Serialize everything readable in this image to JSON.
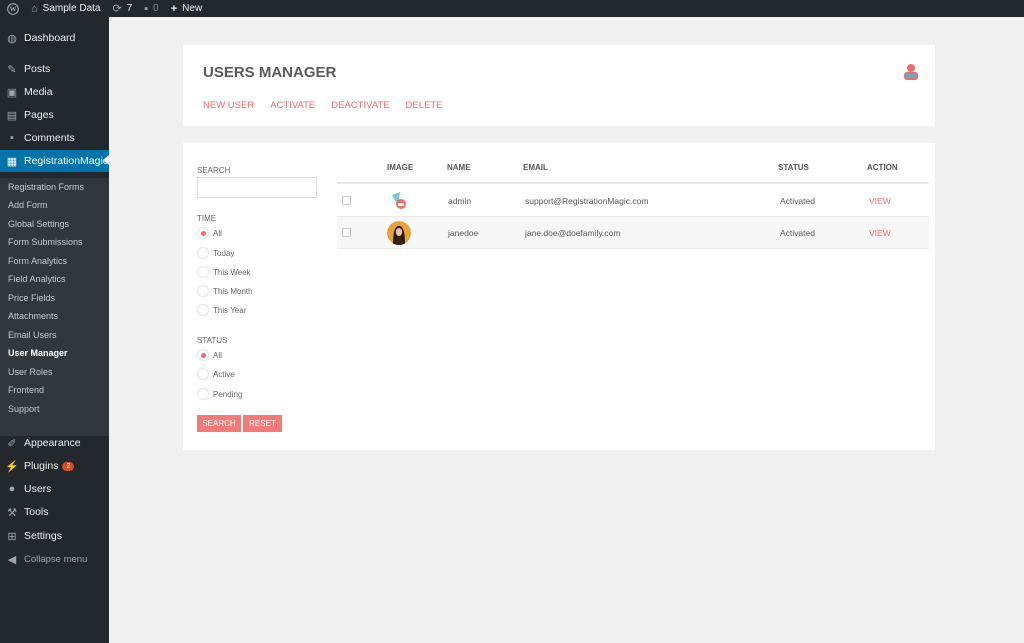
{
  "adminbar": {
    "site_name": "Sample Data",
    "updates": "7",
    "comments": "0",
    "new": "New"
  },
  "sidebar": {
    "items": [
      {
        "label": "Dashboard",
        "icon": "dashboard-icon"
      },
      {
        "label": "Posts",
        "icon": "pin-icon"
      },
      {
        "label": "Media",
        "icon": "media-icon"
      },
      {
        "label": "Pages",
        "icon": "pages-icon"
      },
      {
        "label": "Comments",
        "icon": "comment-icon"
      },
      {
        "label": "RegistrationMagic",
        "icon": "form-icon"
      }
    ],
    "submenu": [
      "Registration Forms",
      "Add Form",
      "Global Settings",
      "Form Submissions",
      "Form Analytics",
      "Field Analytics",
      "Price Fields",
      "Attachments",
      "Email Users",
      "User Manager",
      "User Roles",
      "Frontend",
      "Support"
    ],
    "bottom_items": [
      {
        "label": "Appearance",
        "icon": "brush-icon"
      },
      {
        "label": "Plugins",
        "icon": "plugin-icon",
        "badge": "2"
      },
      {
        "label": "Users",
        "icon": "users-icon"
      },
      {
        "label": "Tools",
        "icon": "wrench-icon"
      },
      {
        "label": "Settings",
        "icon": "settings-icon"
      },
      {
        "label": "Collapse menu",
        "icon": "collapse-icon"
      }
    ]
  },
  "header": {
    "title": "USERS MANAGER",
    "actions": [
      "NEW USER",
      "ACTIVATE",
      "DEACTIVATE",
      "DELETE"
    ]
  },
  "filters": {
    "search_label": "SEARCH",
    "search_value": "",
    "time_label": "TIME",
    "time_options": [
      "All",
      "Today",
      "This Week",
      "This Month",
      "This Year"
    ],
    "time_selected": "All",
    "status_label": "STATUS",
    "status_options": [
      "All",
      "Active",
      "Pending"
    ],
    "status_selected": "All",
    "search_button": "SEARCH",
    "reset_button": "RESET"
  },
  "table": {
    "headers": [
      "IMAGE",
      "NAME",
      "EMAIL",
      "STATUS",
      "ACTION"
    ],
    "rows": [
      {
        "name": "admin",
        "email": "support@RegistrationMagic.com",
        "status": "Activated",
        "action": "VIEW"
      },
      {
        "name": "janedoe",
        "email": "jane.doe@doefamily.com",
        "status": "Activated",
        "action": "VIEW"
      }
    ]
  },
  "colors": {
    "accent": "#f06a67",
    "sidebar_bg": "#23282d",
    "active_menu": "#0073aa"
  }
}
